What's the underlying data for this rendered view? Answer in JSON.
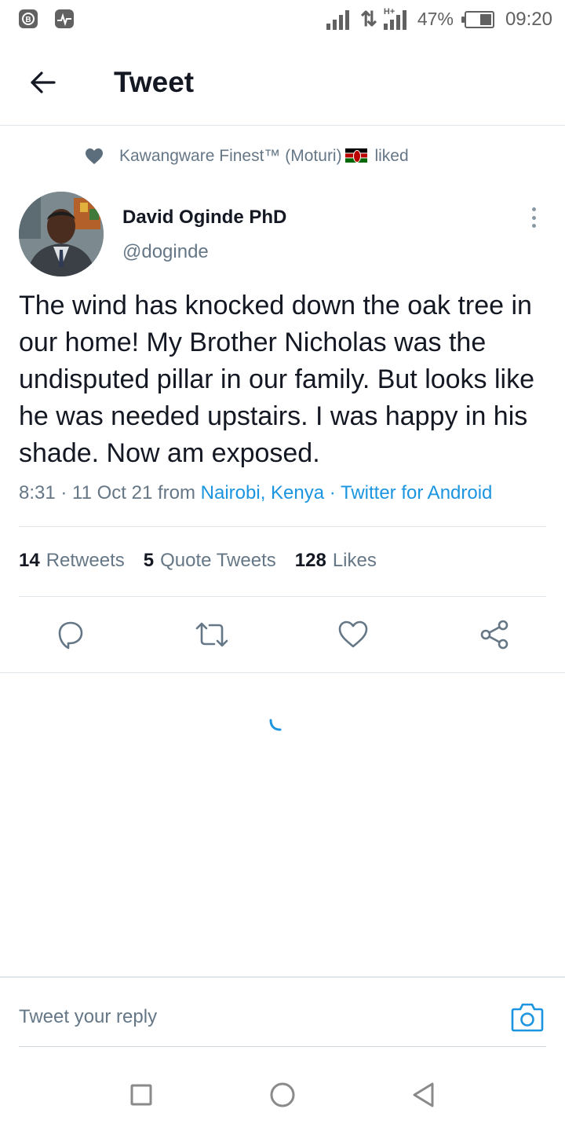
{
  "status_bar": {
    "network_tag": "H+",
    "battery": "47%",
    "battery_level": 0.47,
    "time": "09:20",
    "left_icons": [
      "b-circle-icon",
      "activity-monitor-icon"
    ]
  },
  "header": {
    "title": "Tweet",
    "back_icon": "arrow-left-icon"
  },
  "social_context": {
    "user": "Kawangware Finest™ (Moturi)",
    "action": "liked",
    "icon": "heart-icon"
  },
  "tweet": {
    "author_name": "David Oginde PhD",
    "author_handle": "@doginde",
    "text": "The wind has knocked down the oak tree in our home! My Brother Nicholas was the undisputed pillar in our family. But looks like he was needed upstairs. I was happy in his shade. Now am exposed.",
    "time": "8:31 · 11 Oct 21 from ",
    "location": "Nairobi, Kenya",
    "separator": " · ",
    "source": "Twitter for Android"
  },
  "stats": {
    "retweets_count": "14",
    "retweets_label": "Retweets",
    "quotes_count": "5",
    "quotes_label": "Quote Tweets",
    "likes_count": "128",
    "likes_label": "Likes"
  },
  "actions": [
    "reply-icon",
    "retweet-icon",
    "like-icon",
    "share-icon"
  ],
  "reply": {
    "placeholder": "Tweet your reply"
  },
  "colors": {
    "accent": "#1b95e0",
    "text_primary": "#141823",
    "text_secondary": "#657786",
    "divider": "#e1e6ea"
  }
}
